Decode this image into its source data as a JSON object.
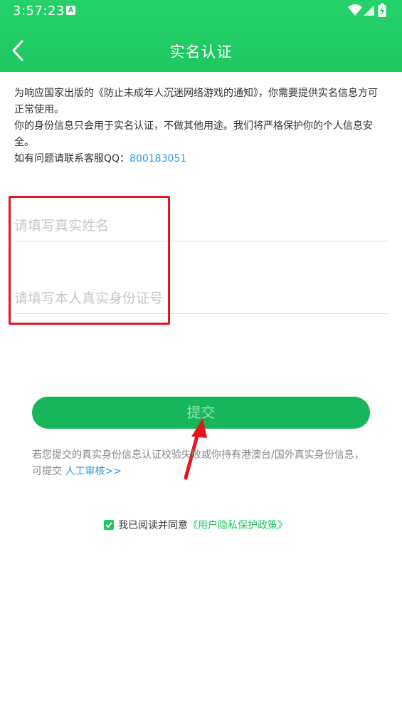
{
  "status_bar": {
    "time": "3:57:23",
    "notification_icon": "A",
    "icons": [
      "wifi-icon",
      "signal-icon",
      "battery-charging-icon"
    ]
  },
  "header": {
    "title": "实名认证",
    "back_icon": "back-chevron-icon"
  },
  "notice": {
    "line1": "为响应国家出版的《防止未成年人沉迷网络游戏的通知》，你需要提供实名信息方可正常使用。",
    "line2": "你的身份信息只会用于实名认证，不做其他用途。我们将严格保护你的个人信息安全。",
    "contact_prefix": "如有问题请联系客服QQ：",
    "qq_number": "800183051"
  },
  "form": {
    "name_placeholder": "请填写真实姓名",
    "name_value": "",
    "id_placeholder": "请填写本人真实身份证号",
    "id_value": ""
  },
  "submit_label": "提交",
  "manual_review": {
    "text": "若您提交的真实身份信息认证校验失败或你持有港澳台/国外真实身份信息，可提交 ",
    "link": "人工审核>>"
  },
  "agreement": {
    "checked": true,
    "text": "我已阅读并同意",
    "link": "《用户隐私保护政策》"
  },
  "colors": {
    "brand_green": "#1ec75f",
    "button_green": "#18b65a",
    "link_blue": "#2a9de0",
    "highlight_red": "#e8141c"
  }
}
